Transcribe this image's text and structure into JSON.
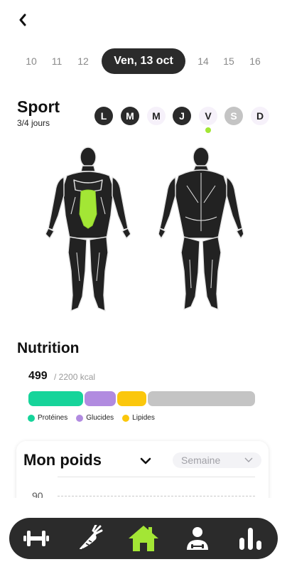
{
  "header": {
    "back_icon": "chevron-left-icon"
  },
  "dates": {
    "before": [
      "10",
      "11",
      "12"
    ],
    "selected": "Ven, 13 oct",
    "after": [
      "14",
      "15",
      "16"
    ]
  },
  "sport": {
    "title": "Sport",
    "progress": "3/4 jours",
    "days": [
      {
        "label": "L",
        "state": "done"
      },
      {
        "label": "M",
        "state": "done"
      },
      {
        "label": "M",
        "state": "todo"
      },
      {
        "label": "J",
        "state": "done"
      },
      {
        "label": "V",
        "state": "todo",
        "today": true
      },
      {
        "label": "S",
        "state": "rest"
      },
      {
        "label": "D",
        "state": "todo"
      }
    ],
    "highlighted_muscle": "abdominals"
  },
  "nutrition": {
    "title": "Nutrition",
    "kcal": "499",
    "goal": "/ 2200 kcal",
    "legend": [
      {
        "label": "Protéines",
        "color": "#16d49a"
      },
      {
        "label": "Glucides",
        "color": "#b18be0"
      },
      {
        "label": "Lipides",
        "color": "#fbc70c"
      }
    ],
    "remaining_color": "#c4c4c4"
  },
  "weight": {
    "title": "Mon poids",
    "period": "Semaine",
    "y_label": "90"
  },
  "colors": {
    "accent": "#a3e635",
    "dark": "#2b2b2b"
  },
  "nav": {
    "items": [
      "dumbbell-icon",
      "carrot-icon",
      "home-icon",
      "profile-icon",
      "stats-icon"
    ],
    "active": "home-icon"
  }
}
